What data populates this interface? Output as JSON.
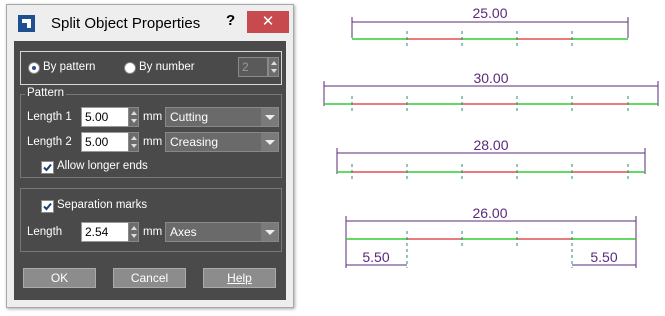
{
  "dialog": {
    "title": "Split Object Properties",
    "help_label": "?",
    "close_label": "✕",
    "mode": {
      "by_pattern_label": "By pattern",
      "by_number_label": "By number",
      "selected": "By pattern",
      "number_value": "2"
    },
    "pattern": {
      "legend": "Pattern",
      "length1_label": "Length 1",
      "length1_value": "5.00",
      "length1_unit": "mm",
      "length1_type": "Cutting",
      "length2_label": "Length 2",
      "length2_value": "5.00",
      "length2_unit": "mm",
      "length2_type": "Creasing",
      "allow_longer_label": "Allow longer ends",
      "allow_longer_checked": true
    },
    "separation": {
      "label": "Separation marks",
      "checked": true,
      "length_label": "Length",
      "length_value": "2.54",
      "length_unit": "mm",
      "type": "Axes"
    },
    "buttons": {
      "ok": "OK",
      "cancel": "Cancel",
      "help": "Help"
    }
  },
  "drawing": {
    "colors": {
      "dimension": "#5a2a7a",
      "cut": "#e05050",
      "crease": "#33cc33",
      "axis": "#2a8a7a"
    },
    "lines": [
      {
        "dimension": "25.00"
      },
      {
        "dimension": "30.00"
      },
      {
        "dimension": "28.00"
      },
      {
        "dimension": "26.00",
        "left_end": "5.50",
        "right_end": "5.50"
      }
    ]
  }
}
